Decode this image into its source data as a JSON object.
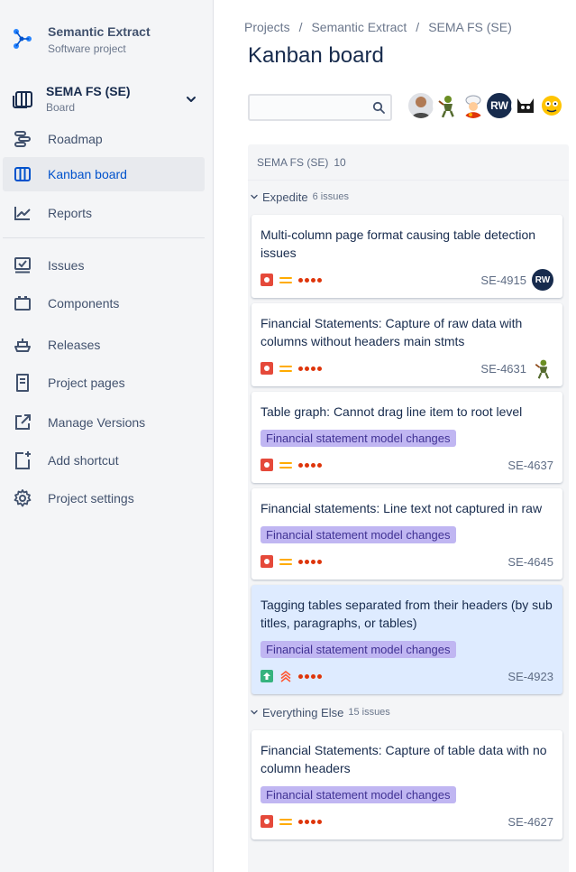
{
  "project": {
    "name": "Semantic Extract",
    "type": "Software project"
  },
  "board_selector": {
    "name": "SEMA FS (SE)",
    "sub": "Board"
  },
  "nav": [
    {
      "label": "Roadmap",
      "icon": "roadmap-icon"
    },
    {
      "label": "Kanban board",
      "icon": "board-icon",
      "active": true
    },
    {
      "label": "Reports",
      "icon": "reports-icon"
    },
    {
      "label": "Issues",
      "icon": "issues-icon"
    },
    {
      "label": "Components",
      "icon": "components-icon"
    },
    {
      "label": "Releases",
      "icon": "releases-icon"
    },
    {
      "label": "Project pages",
      "icon": "pages-icon"
    },
    {
      "label": "Manage Versions",
      "icon": "external-link-icon"
    },
    {
      "label": "Add shortcut",
      "icon": "add-shortcut-icon"
    },
    {
      "label": "Project settings",
      "icon": "gear-icon"
    }
  ],
  "breadcrumb": [
    "Projects",
    "Semantic Extract",
    "SEMA FS (SE)"
  ],
  "page_title": "Kanban board",
  "search": {
    "value": "",
    "placeholder": ""
  },
  "avatars": [
    {
      "name": "person-avatar"
    },
    {
      "name": "character-avatar"
    },
    {
      "name": "chef-avatar"
    },
    {
      "name": "rw-avatar",
      "initials": "RW"
    },
    {
      "name": "cat-avatar"
    },
    {
      "name": "robot-avatar"
    }
  ],
  "column": {
    "title": "SEMA FS (SE)",
    "count": "10"
  },
  "swimlanes": [
    {
      "title": "Expedite",
      "issues": "6 issues",
      "cards": [
        {
          "summary": "Multi-column page format causing table detection issues",
          "epic": "",
          "type": "bug",
          "priority": "medium",
          "key": "SE-4915",
          "assignee": "RW"
        },
        {
          "summary": "Financial Statements: Capture of raw data with columns without headers main stmts",
          "epic": "",
          "type": "bug",
          "priority": "medium",
          "key": "SE-4631",
          "assignee": "character"
        },
        {
          "summary": "Table graph: Cannot drag line item to root level",
          "epic": "Financial statement model changes",
          "type": "bug",
          "priority": "medium",
          "key": "SE-4637",
          "assignee": ""
        },
        {
          "summary": "Financial statements: Line text not captured in raw",
          "epic": "Financial statement model changes",
          "type": "bug",
          "priority": "medium",
          "key": "SE-4645",
          "assignee": ""
        },
        {
          "summary": "Tagging tables separated from their headers (by sub titles, paragraphs, or tables)",
          "epic": "Financial statement model changes",
          "type": "improvement",
          "priority": "highest",
          "key": "SE-4923",
          "assignee": "",
          "selected": true
        }
      ]
    },
    {
      "title": "Everything Else",
      "issues": "15 issues",
      "cards": [
        {
          "summary": "Financial Statements: Capture of table data with no column headers",
          "epic": "Financial statement model changes",
          "type": "bug",
          "priority": "medium",
          "key": "SE-4627",
          "assignee": ""
        }
      ]
    }
  ],
  "colors": {
    "accent": "#0052cc",
    "epic_bg": "#c0b6f2",
    "epic_text": "#403294",
    "bug": "#e5493a",
    "improvement": "#36b37e",
    "priority_medium": "#ffab00",
    "priority_high": "#ff5630",
    "selected_card": "#deebff"
  }
}
